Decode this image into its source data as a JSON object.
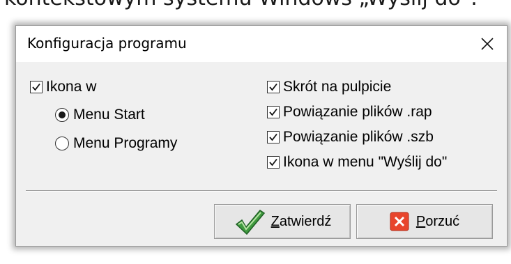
{
  "background": {
    "text": "kontekstowym systemu Windows „Wyślij do”."
  },
  "dialog": {
    "title": "Konfiguracja programu",
    "close_icon": "close-icon",
    "ikona_w": {
      "label": "Ikona w",
      "checked": true
    },
    "radios": [
      {
        "label": "Menu Start",
        "selected": true
      },
      {
        "label": "Menu Programy",
        "selected": false
      }
    ],
    "right_checks": [
      {
        "label": "Skrót na pulpicie",
        "checked": true
      },
      {
        "label": "Powiązanie plików .rap",
        "checked": true
      },
      {
        "label": "Powiązanie plików .szb",
        "checked": true
      },
      {
        "label": "Ikona w menu \"Wyślij do\"",
        "checked": true
      }
    ],
    "buttons": {
      "confirm": {
        "mnemonic": "Z",
        "rest": "atwierdź",
        "icon": "checkmark-icon",
        "icon_color": "#2e7d32"
      },
      "cancel": {
        "mnemonic": "P",
        "rest": "orzuć",
        "icon": "x-icon",
        "icon_color": "#e8452c"
      }
    }
  }
}
